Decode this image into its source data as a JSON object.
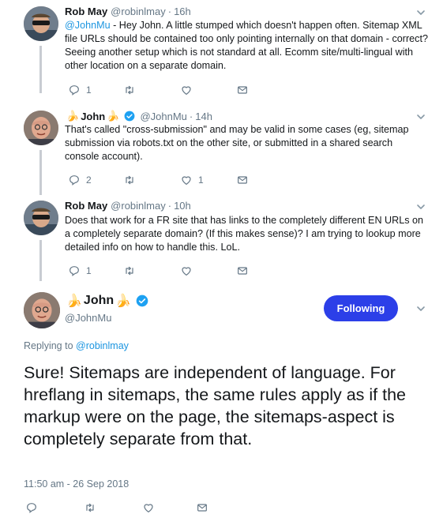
{
  "tweets": [
    {
      "name": "Rob May",
      "handle": "@robinlmay",
      "time": "16h",
      "text_mention": "@JohnMu",
      "text": " - Hey John. A little stumped which doesn't happen often. Sitemap XML file URLs should be contained too only pointing internally on that domain - correct? Seeing another setup which is not standard at all. Ecomm site/multi-lingual with other location on a separate domain.",
      "reply_count": "1",
      "retweet_count": "",
      "like_count": ""
    },
    {
      "name": "John",
      "handle": "@JohnMu",
      "time": "14h",
      "text": "That's called \"cross-submission\" and may be valid in some cases (eg, sitemap submission via robots.txt on the other site, or submitted in a shared search console account).",
      "reply_count": "2",
      "retweet_count": "",
      "like_count": "1"
    },
    {
      "name": "Rob May",
      "handle": "@robinlmay",
      "time": "10h",
      "text": "Does that work for a FR site that has links to the completely different EN URLs on a completely separate domain? (If this makes sense)? I am trying to lookup more detailed info on how to handle this. LoL.",
      "reply_count": "1",
      "retweet_count": "",
      "like_count": ""
    }
  ],
  "main_tweet": {
    "name": "John",
    "handle": "@JohnMu",
    "follow_label": "Following",
    "replying_prefix": "Replying to ",
    "replying_to": "@robinlmay",
    "text": "Sure! Sitemaps are independent of language. For hreflang in sitemaps, the same rules apply as if the markup were on the page, the sitemaps-aspect is completely separate from that.",
    "timestamp": "11:50 am - 26 Sep 2018"
  },
  "glyphs": {
    "dot": "·",
    "banana": "🍌"
  },
  "colors": {
    "link": "#1b95e0",
    "follow_button": "#2c3fe8",
    "verified": "#1da1f2",
    "muted": "#657786"
  }
}
